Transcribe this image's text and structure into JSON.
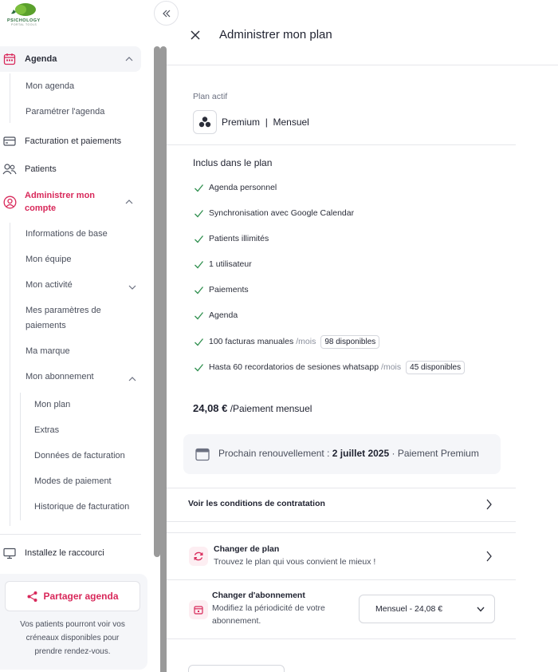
{
  "brand": {
    "name": "PSICHOLOGY",
    "sub": "PORTAL TOOLS"
  },
  "sidebar": {
    "agenda": {
      "label": "Agenda",
      "items": [
        "Mon agenda",
        "Paramétrer l'agenda"
      ]
    },
    "billing": "Facturation et paiements",
    "patients": "Patients",
    "account": {
      "label_line1": "Administrer mon",
      "label_line2": "compte",
      "items": [
        "Informations de base",
        "Mon équipe",
        "Mon activité"
      ],
      "payments_line1": "Mes paramètres de",
      "payments_line2": "paiements",
      "brand_item": "Ma marque",
      "subscription": {
        "label": "Mon abonnement",
        "items": [
          "Mon plan",
          "Extras",
          "Données de facturation",
          "Modes de paiement",
          "Historique de facturation"
        ]
      }
    },
    "shortcut": "Installez le raccourci",
    "share": {
      "button": "Partager agenda",
      "desc_line1": "Vos patients pourront voir vos",
      "desc_line2": "créneaux disponibles pour",
      "desc_line3": "prendre rendez-vous."
    }
  },
  "panel": {
    "title": "Administrer mon plan",
    "plan_label": "Plan actif",
    "plan_name": "Premium",
    "plan_sep": "|",
    "plan_period": "Mensuel",
    "included_title": "Inclus dans le plan",
    "features": [
      {
        "text": "Agenda personnel"
      },
      {
        "text": "Synchronisation avec Google Calendar"
      },
      {
        "text": "Patients illimités"
      },
      {
        "text": "1 utilisateur"
      },
      {
        "text": "Paiements"
      },
      {
        "text": "Agenda"
      },
      {
        "text": "100 facturas manuales",
        "per": "/mois",
        "badge": "98 disponibles"
      },
      {
        "text": "Hasta 60 recordatorios de sesiones whatsapp",
        "per": "/mois",
        "badge": "45 disponibles"
      }
    ],
    "price": "24,08 €",
    "price_suffix": "/Paiement mensuel",
    "renewal_prefix": "Prochain renouvellement :",
    "renewal_date": "2 juillet 2025",
    "renewal_suffix": "· Paiement Premium",
    "conditions": "Voir les conditions de contratation",
    "change_plan": {
      "title": "Changer de plan",
      "desc": "Trouvez le plan qui vous convient le mieux !"
    },
    "change_sub": {
      "title": "Changer d'abonnement",
      "desc_line1": "Modifiez la périodicité de votre",
      "desc_line2": "abonnement.",
      "select_value": "Mensuel - 24,08 €"
    }
  },
  "colors": {
    "accent": "#d8285a",
    "check": "#2f8f4e",
    "brand_green": "#5aa02c"
  }
}
